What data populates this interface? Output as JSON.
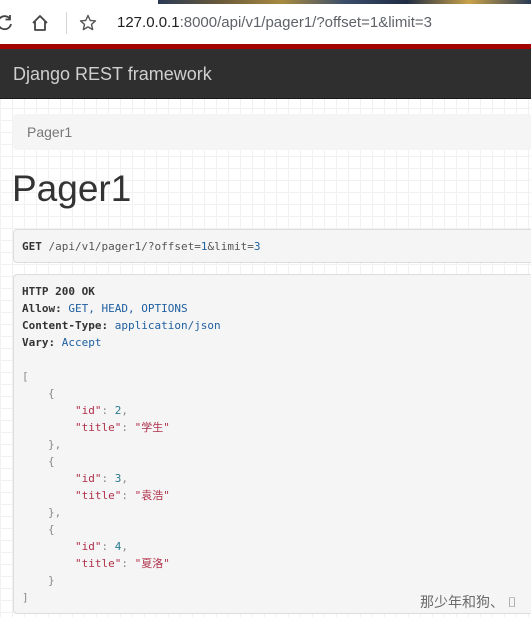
{
  "browser": {
    "url_host": "127.0.0.1",
    "url_rest": ":8000/api/v1/pager1/?offset=1&limit=3",
    "icons": [
      "reload-icon",
      "home-icon",
      "star-icon"
    ]
  },
  "navbar": {
    "brand": "Django REST framework"
  },
  "breadcrumb": {
    "item": "Pager1"
  },
  "page": {
    "title": "Pager1"
  },
  "request": {
    "method": "GET",
    "path": "/api/v1/pager1/?offset=",
    "offset_value": "1",
    "amp_limit": "&limit=",
    "limit_value": "3"
  },
  "response": {
    "status": "HTTP 200 OK",
    "headers": [
      {
        "key": "Allow:",
        "value": "GET, HEAD, OPTIONS"
      },
      {
        "key": "Content-Type:",
        "value": "application/json"
      },
      {
        "key": "Vary:",
        "value": "Accept"
      }
    ],
    "items": [
      {
        "id": "2",
        "title": "\"学生\""
      },
      {
        "id": "3",
        "title": "\"袁浩\""
      },
      {
        "id": "4",
        "title": "\"夏洛\""
      }
    ],
    "labels": {
      "open_bracket": "[",
      "close_bracket": "]",
      "open_brace": "{",
      "close_brace_comma": "},",
      "close_brace": "}",
      "id_key": "\"id\"",
      "title_key": "\"title\"",
      "colon": ": ",
      "comma": ","
    }
  },
  "watermark": {
    "text": "那少年和狗、 ⌷"
  },
  "colors": {
    "navbar": "#2f2f2f",
    "accent_line": "#a30000",
    "link_blue": "#2060a0",
    "string_red": "#b0304a"
  }
}
